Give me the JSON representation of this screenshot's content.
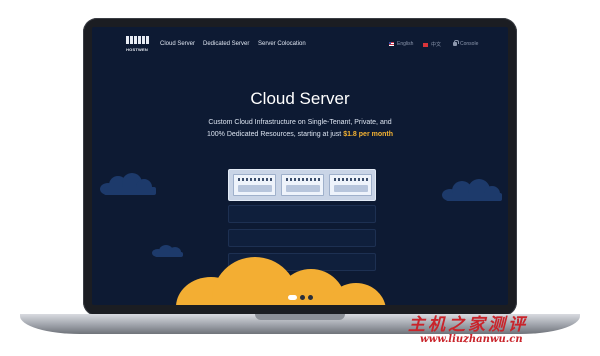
{
  "nav": {
    "logo_text": "HOSTWEN",
    "links": [
      "Cloud Server",
      "Dedicated Server",
      "Server Colocation"
    ],
    "lang_en": "English",
    "lang_cn": "中文",
    "console": "Console"
  },
  "hero": {
    "title": "Cloud Server",
    "subtitle_line1": "Custom Cloud Infrastructure on Single-Tenant, Private, and",
    "subtitle_line2": "100% Dedicated Resources, starting at just",
    "price": "$1.8 per month"
  },
  "pager": {
    "count": 3,
    "active": 0
  },
  "watermark": {
    "cn": "主机之家测评",
    "url": "www.liuzhanwu.cn"
  },
  "colors": {
    "background": "#0d1a33",
    "accent": "#f4b233",
    "cloud": "#1d3a6b",
    "sun_cloud": "#f3ae33"
  }
}
